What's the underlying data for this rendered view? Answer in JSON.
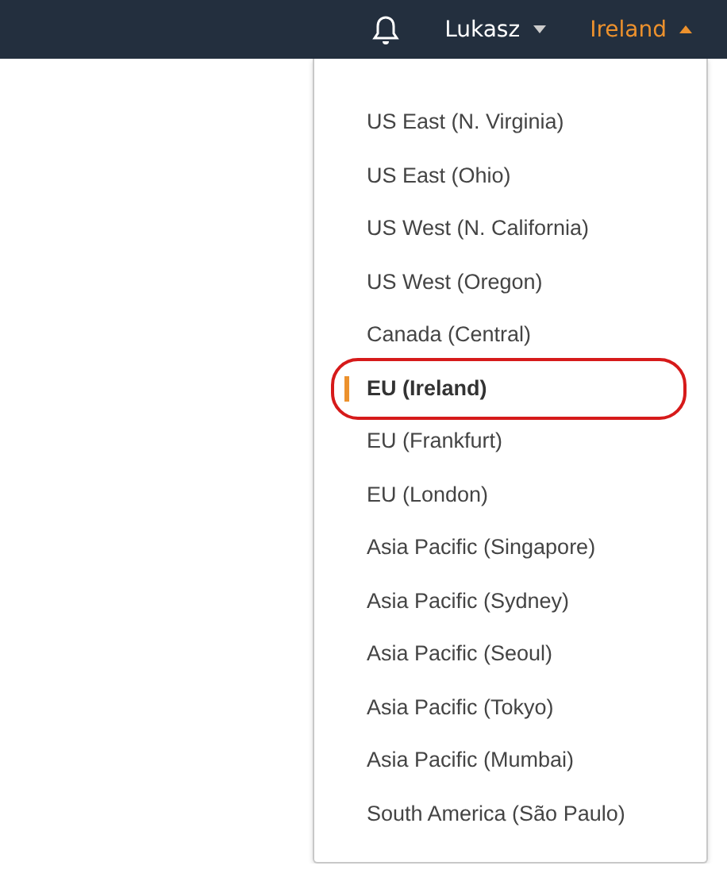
{
  "top_bar": {
    "user": "Lukasz",
    "region": "Ireland",
    "region_menu_expanded": true
  },
  "region_menu": {
    "items": [
      {
        "label": "US East (N. Virginia)",
        "selected": false
      },
      {
        "label": "US East (Ohio)",
        "selected": false
      },
      {
        "label": "US West (N. California)",
        "selected": false
      },
      {
        "label": "US West (Oregon)",
        "selected": false
      },
      {
        "label": "Canada (Central)",
        "selected": false
      },
      {
        "label": "EU (Ireland)",
        "selected": true,
        "circled": true
      },
      {
        "label": "EU (Frankfurt)",
        "selected": false
      },
      {
        "label": "EU (London)",
        "selected": false
      },
      {
        "label": "Asia Pacific (Singapore)",
        "selected": false
      },
      {
        "label": "Asia Pacific (Sydney)",
        "selected": false
      },
      {
        "label": "Asia Pacific (Seoul)",
        "selected": false
      },
      {
        "label": "Asia Pacific (Tokyo)",
        "selected": false
      },
      {
        "label": "Asia Pacific (Mumbai)",
        "selected": false
      },
      {
        "label": "South America (São Paulo)",
        "selected": false
      }
    ]
  }
}
